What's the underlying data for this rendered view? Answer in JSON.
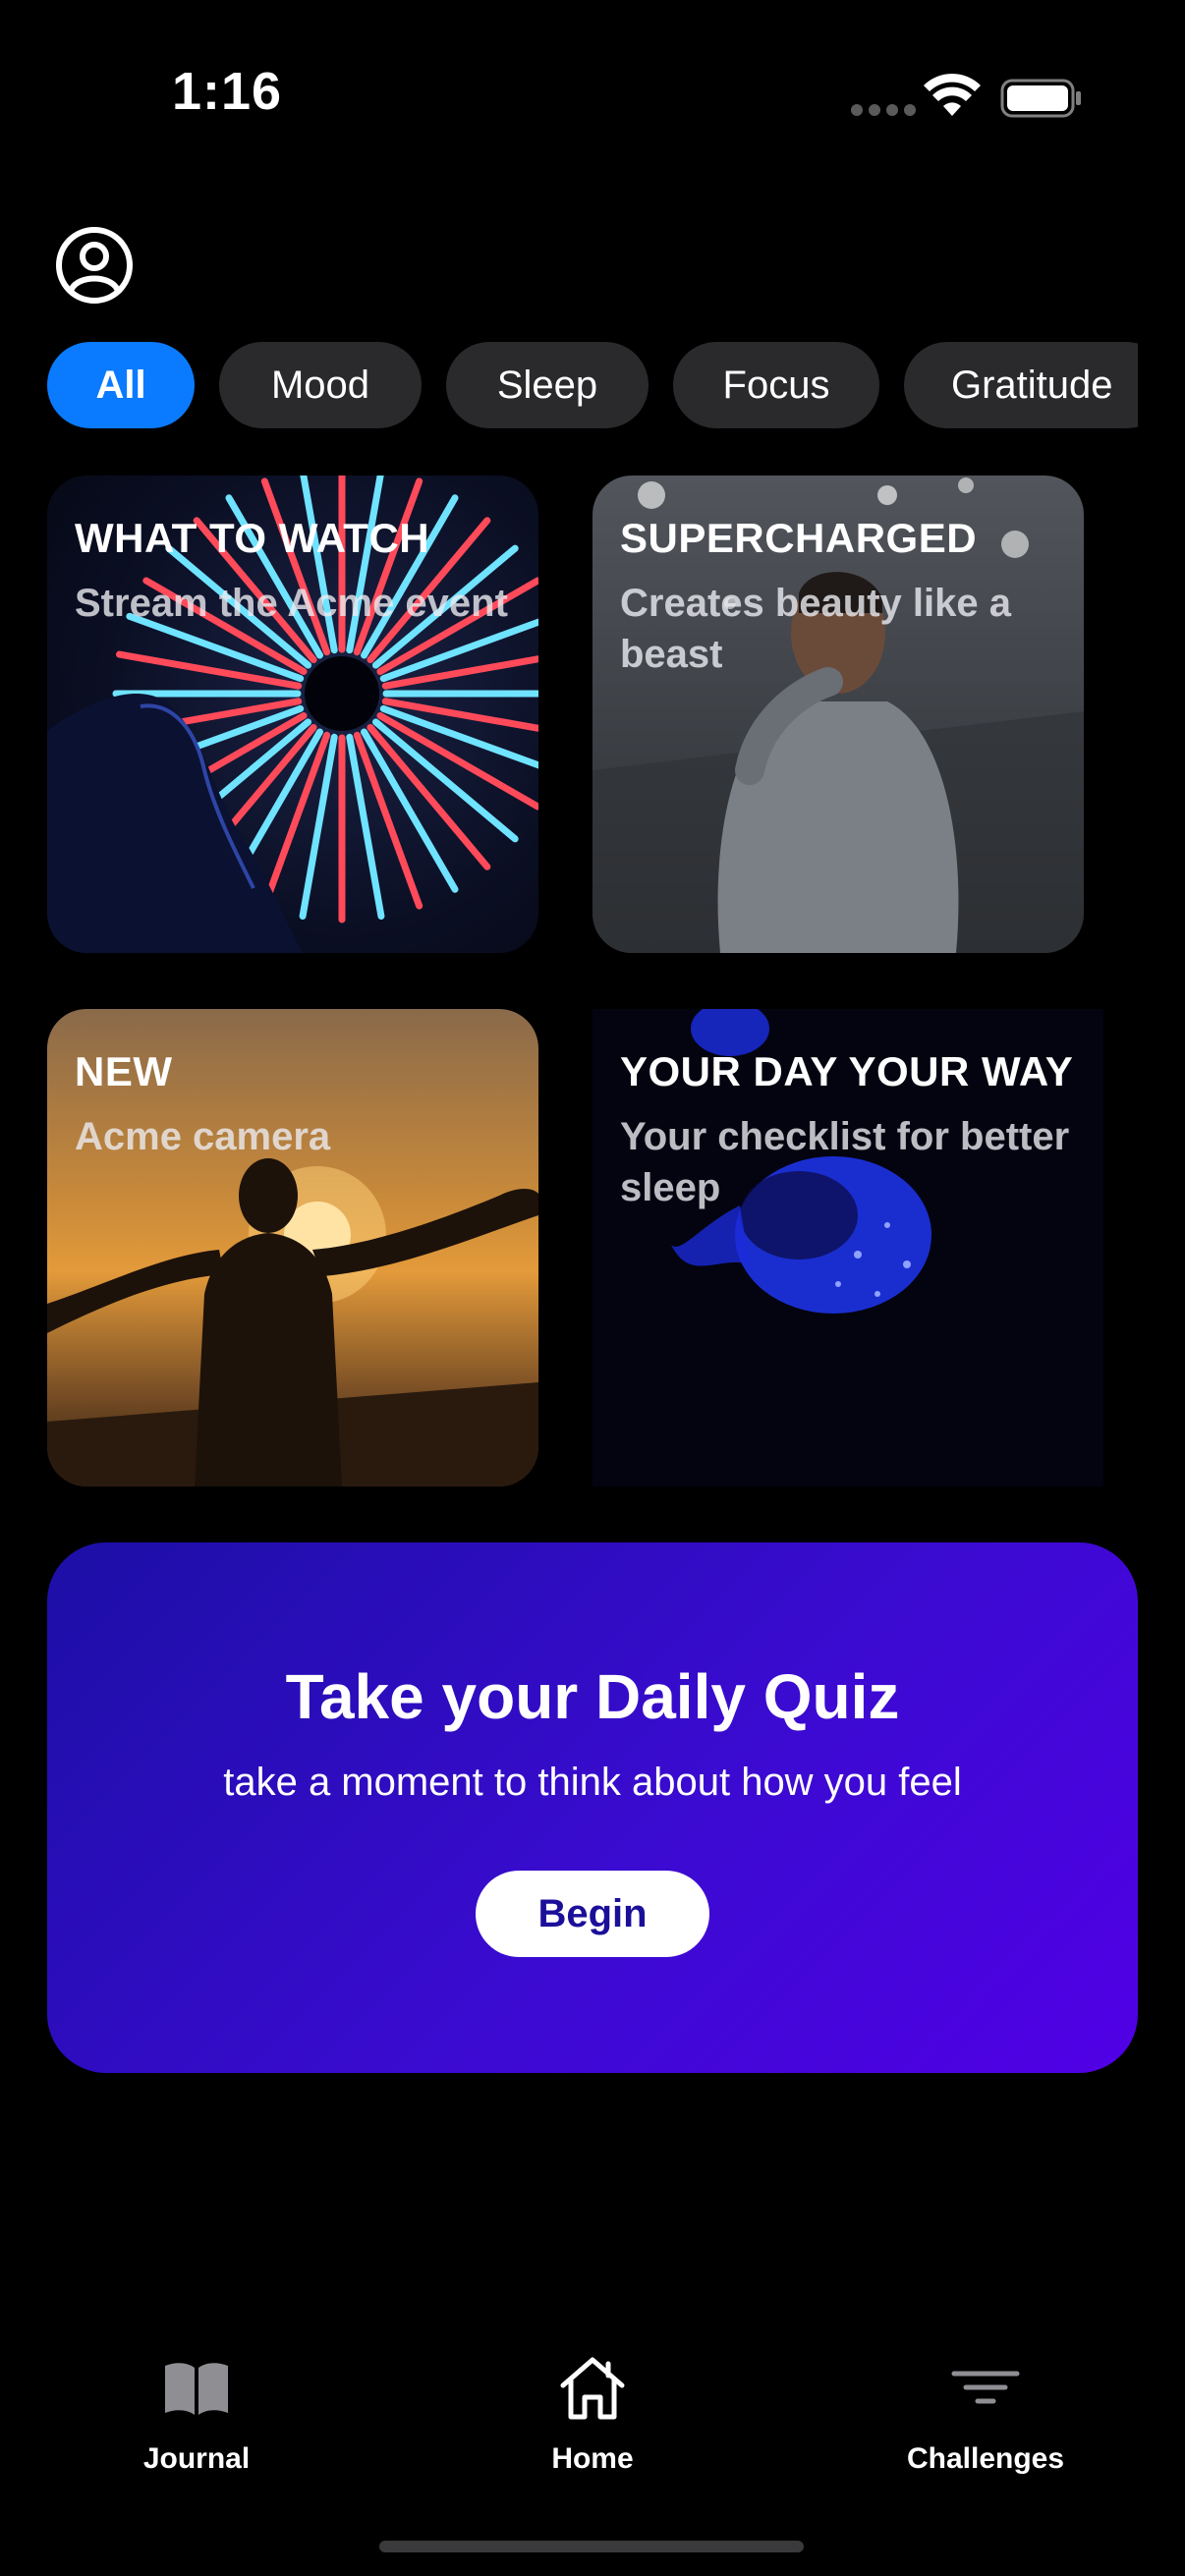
{
  "status_bar": {
    "time": "1:16"
  },
  "chips": [
    {
      "label": "All",
      "active": true
    },
    {
      "label": "Mood",
      "active": false
    },
    {
      "label": "Sleep",
      "active": false
    },
    {
      "label": "Focus",
      "active": false
    },
    {
      "label": "Gratitude",
      "active": false
    }
  ],
  "tiles": [
    {
      "title": "WHAT TO WATCH",
      "subtitle": "Stream the Acme event"
    },
    {
      "title": "SUPERCHARGED",
      "subtitle": "Creates beauty like a beast"
    },
    {
      "title": "NEW",
      "subtitle": "Acme camera"
    },
    {
      "title": "YOUR DAY YOUR WAY",
      "subtitle": "Your checklist for better sleep"
    }
  ],
  "quiz": {
    "title": "Take your Daily Quiz",
    "subtitle": "take a moment to think about how you feel",
    "button": "Begin"
  },
  "tabbar": {
    "items": [
      {
        "label": "Journal",
        "icon": "book-icon"
      },
      {
        "label": "Home",
        "icon": "house-icon"
      },
      {
        "label": "Challenges",
        "icon": "filter-lines-icon"
      }
    ]
  },
  "colors": {
    "accent": "#0a7bff",
    "chip_bg": "#2a2a2c",
    "quiz_gradient_start": "#1c0fa6",
    "quiz_gradient_end": "#5100e6",
    "quiz_button_text": "#1b0f9a"
  }
}
